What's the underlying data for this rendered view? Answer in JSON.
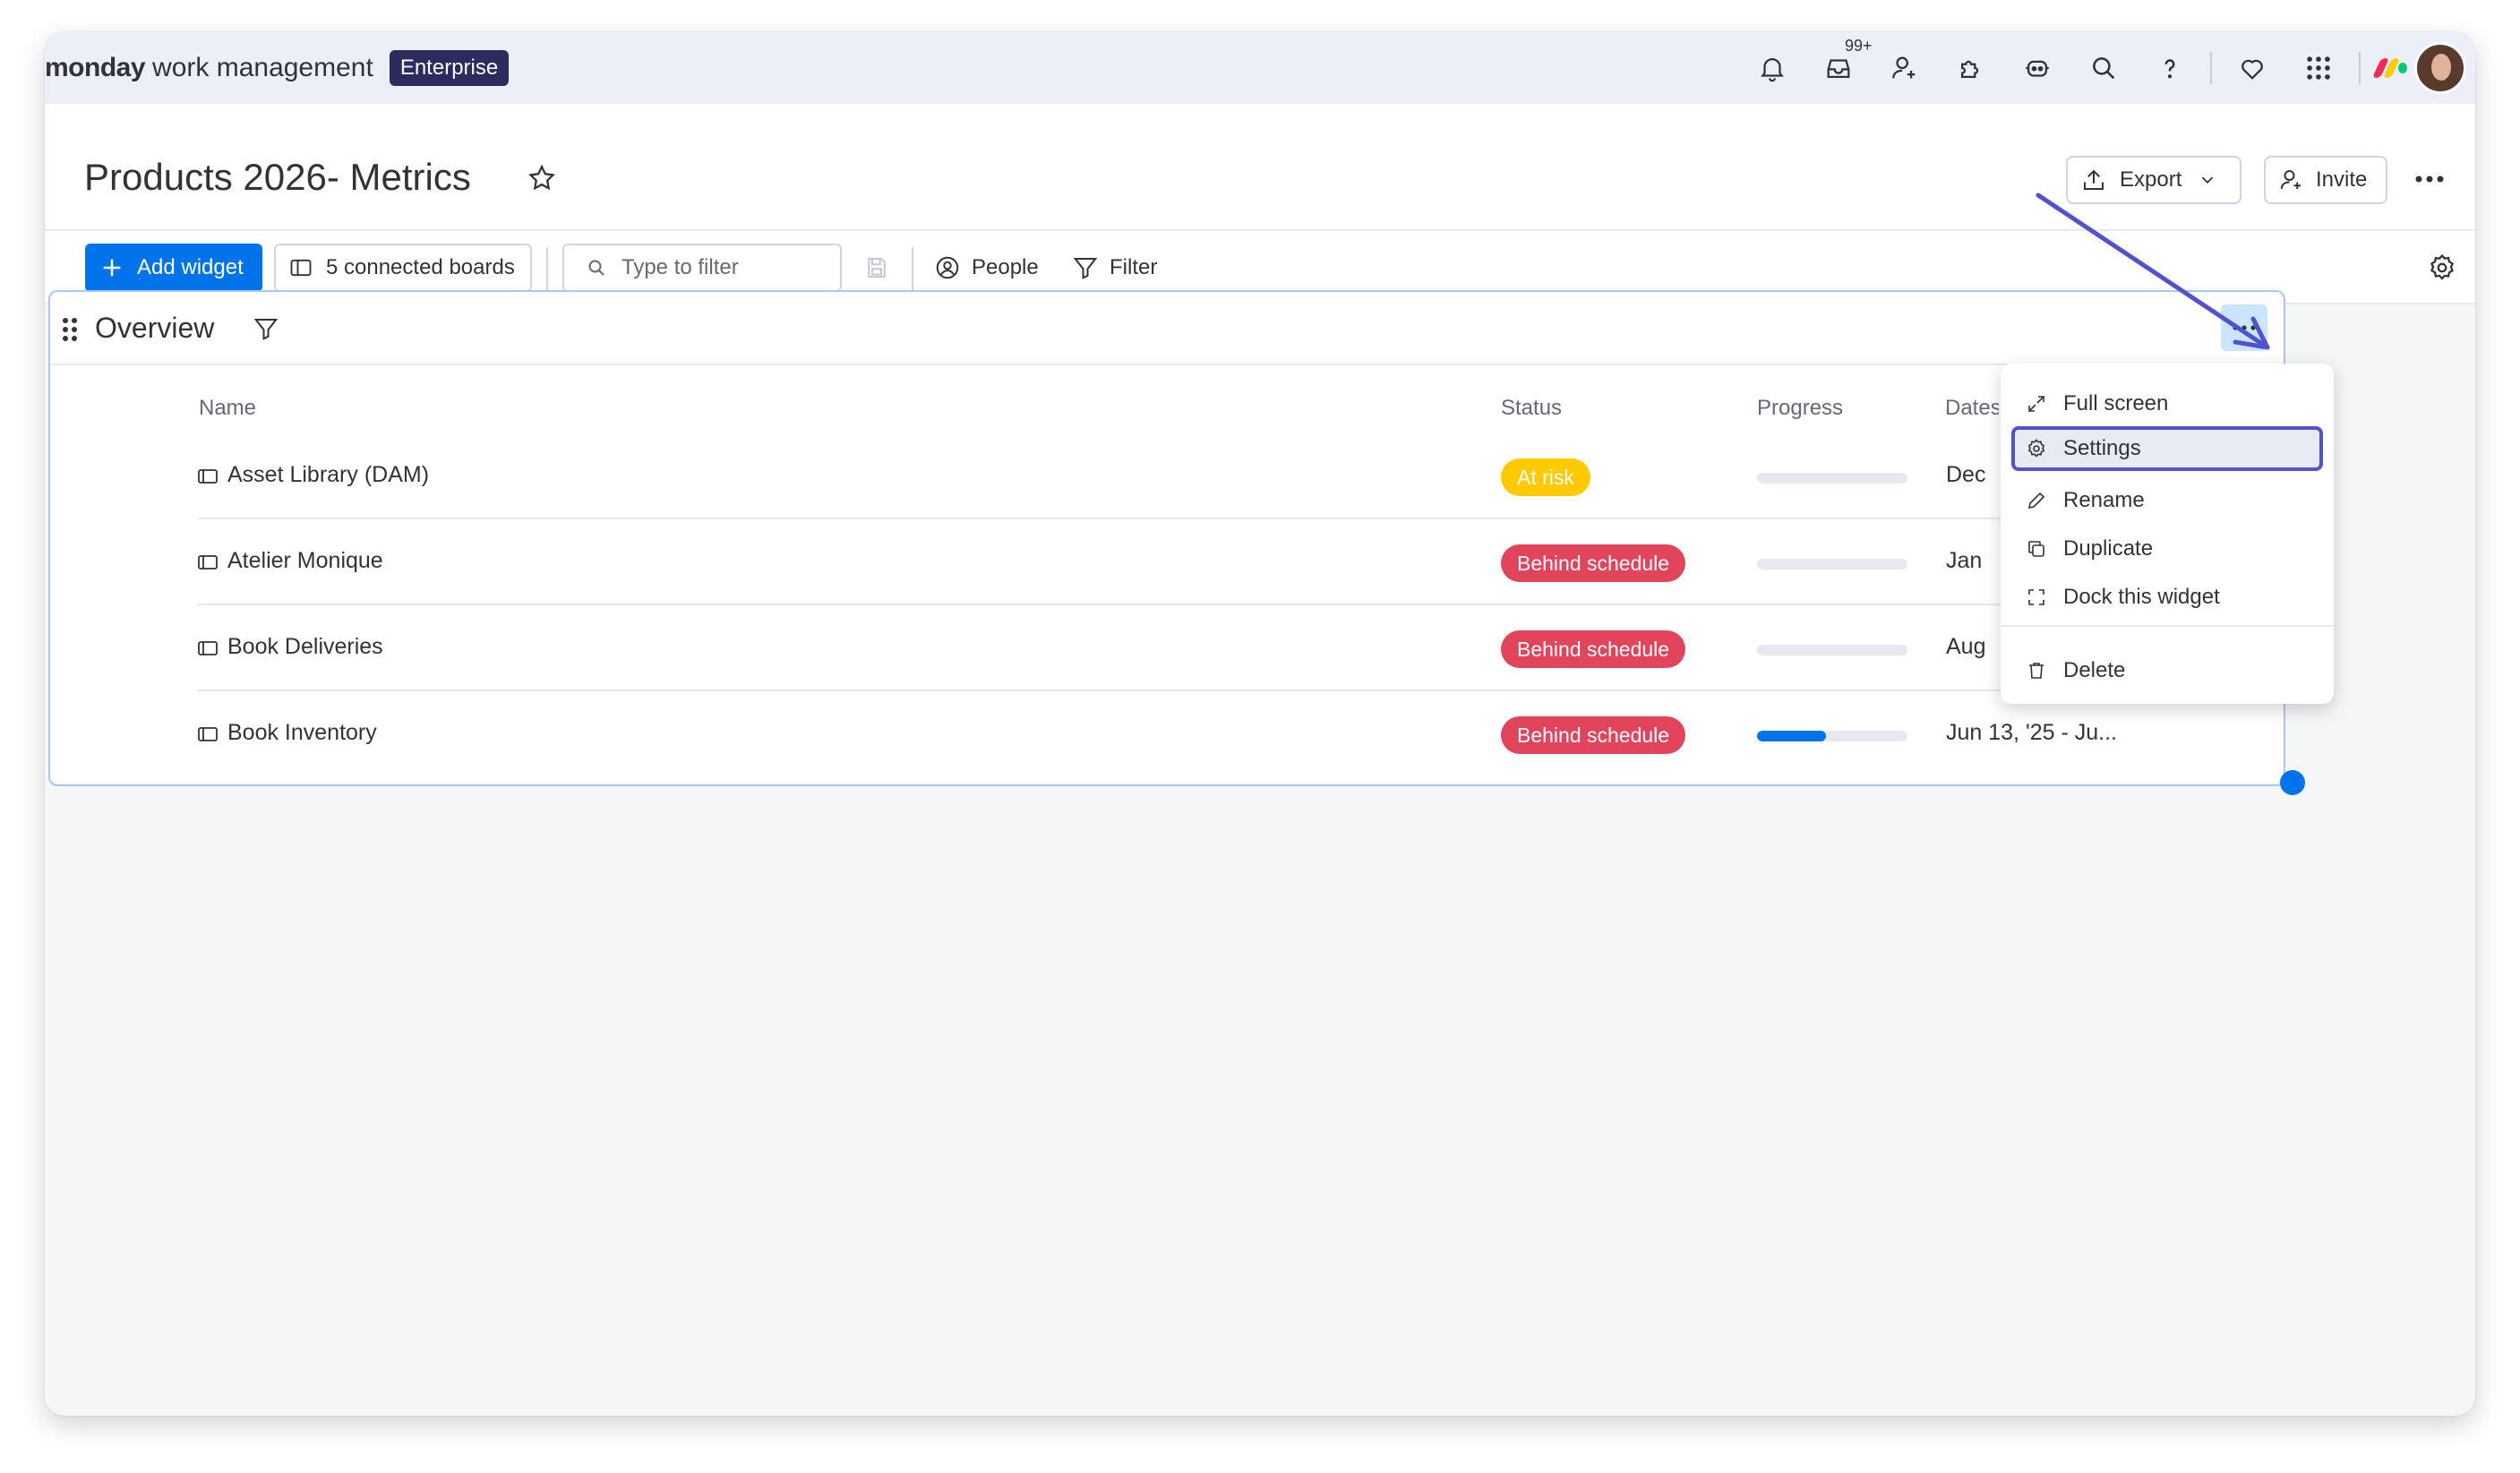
{
  "topbar": {
    "brand_bold": "monday",
    "brand_rest": "work management",
    "plan_badge": "Enterprise",
    "notification_count": "99+",
    "icons": [
      "bell-icon",
      "inbox-icon",
      "invite-members-icon",
      "apps-icon",
      "ai-assistant-icon",
      "search-icon",
      "help-icon",
      "heart-icon",
      "product-switcher-icon"
    ]
  },
  "board": {
    "title": "Products 2026- Metrics",
    "export_label": "Export",
    "invite_label": "Invite"
  },
  "toolbar": {
    "add_widget_label": "Add widget",
    "connected_boards_label": "5 connected boards",
    "filter_placeholder": "Type to filter",
    "people_label": "People",
    "filter_label": "Filter"
  },
  "widget": {
    "title": "Overview",
    "columns": {
      "name": "Name",
      "status": "Status",
      "progress": "Progress",
      "dates": "Dates"
    },
    "rows": [
      {
        "name": "Asset Library (DAM)",
        "status": "At risk",
        "status_color": "#ffcb00",
        "progress": 0,
        "dates": "Dec 1"
      },
      {
        "name": "Atelier Monique",
        "status": "Behind schedule",
        "status_color": "#e2445c",
        "progress": 0,
        "dates": "Jan 2"
      },
      {
        "name": "Book Deliveries",
        "status": "Behind schedule",
        "status_color": "#e2445c",
        "progress": 0,
        "dates": "Aug 1"
      },
      {
        "name": "Book Inventory",
        "status": "Behind schedule",
        "status_color": "#e2445c",
        "progress": 0.46,
        "dates": "Jun 13, '25 - Ju..."
      }
    ]
  },
  "menu": {
    "items": [
      {
        "label": "Full screen",
        "icon": "expand-icon"
      },
      {
        "label": "Settings",
        "icon": "gear-icon"
      },
      {
        "label": "Rename",
        "icon": "pencil-icon"
      },
      {
        "label": "Duplicate",
        "icon": "duplicate-icon"
      },
      {
        "label": "Dock this widget",
        "icon": "dock-icon"
      },
      {
        "label": "Delete",
        "icon": "trash-icon"
      }
    ]
  },
  "colors": {
    "accent": "#0073ea",
    "highlight": "#5052d1",
    "at_risk": "#ffcb00",
    "behind": "#e2445c"
  }
}
